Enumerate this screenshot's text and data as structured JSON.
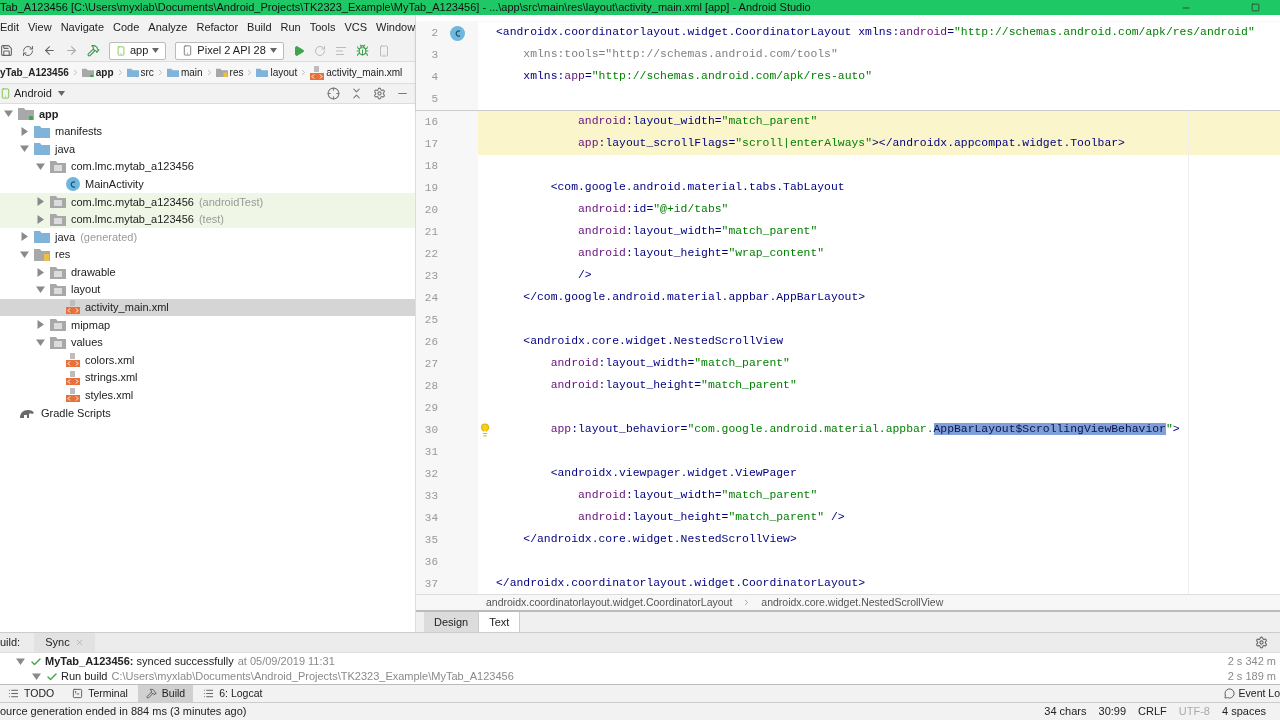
{
  "window": {
    "title": "Tab_A123456 [C:\\Users\\myxlab\\Documents\\Android_Projects\\TK2323_Example\\MyTab_A123456] - ...\\app\\src\\main\\res\\layout\\activity_main.xml [app] - Android Studio"
  },
  "menu": [
    "Edit",
    "View",
    "Navigate",
    "Code",
    "Analyze",
    "Refactor",
    "Build",
    "Run",
    "Tools",
    "VCS",
    "Window"
  ],
  "toolbar": {
    "module": "app",
    "device": "Pixel 2 API 28"
  },
  "breadcrumb": [
    {
      "label": "yTab_A123456",
      "kind": "project"
    },
    {
      "label": "app",
      "kind": "module"
    },
    {
      "label": "src",
      "kind": "folder"
    },
    {
      "label": "main",
      "kind": "folder"
    },
    {
      "label": "res",
      "kind": "res"
    },
    {
      "label": "layout",
      "kind": "folder"
    },
    {
      "label": "activity_main.xml",
      "kind": "xml"
    }
  ],
  "project": {
    "view": "Android",
    "tree": [
      {
        "label": "app",
        "kind": "module",
        "selected": false,
        "highlighted": false,
        "expanded": true,
        "children": [
          {
            "label": "manifests",
            "kind": "folder",
            "selected": false,
            "highlighted": false,
            "expanded": false
          },
          {
            "label": "java",
            "kind": "folder",
            "selected": false,
            "highlighted": false,
            "expanded": true,
            "children": [
              {
                "label": "com.lmc.mytab_a123456",
                "kind": "package",
                "selected": false,
                "highlighted": false,
                "expanded": true,
                "children": [
                  {
                    "label": "MainActivity",
                    "kind": "class",
                    "selected": false,
                    "highlighted": false
                  }
                ]
              },
              {
                "label": "com.lmc.mytab_a123456",
                "suffix": "(androidTest)",
                "kind": "package",
                "selected": false,
                "highlighted": true,
                "expanded": false
              },
              {
                "label": "com.lmc.mytab_a123456",
                "suffix": "(test)",
                "kind": "package",
                "selected": false,
                "highlighted": true,
                "expanded": false
              }
            ]
          },
          {
            "label": "java",
            "suffix": "(generated)",
            "kind": "generated",
            "selected": false,
            "highlighted": false,
            "expanded": false
          },
          {
            "label": "res",
            "kind": "res",
            "selected": false,
            "highlighted": false,
            "expanded": true,
            "children": [
              {
                "label": "drawable",
                "kind": "package",
                "selected": false,
                "highlighted": false,
                "expanded": false
              },
              {
                "label": "layout",
                "kind": "package",
                "selected": false,
                "highlighted": false,
                "expanded": true,
                "children": [
                  {
                    "label": "activity_main.xml",
                    "kind": "xml",
                    "selected": true,
                    "highlighted": false
                  }
                ]
              },
              {
                "label": "mipmap",
                "kind": "package",
                "selected": false,
                "highlighted": false,
                "expanded": false
              },
              {
                "label": "values",
                "kind": "package",
                "selected": false,
                "highlighted": false,
                "expanded": true,
                "children": [
                  {
                    "label": "colors.xml",
                    "kind": "xml",
                    "selected": false,
                    "highlighted": false
                  },
                  {
                    "label": "strings.xml",
                    "kind": "xml",
                    "selected": false,
                    "highlighted": false
                  },
                  {
                    "label": "styles.xml",
                    "kind": "xml",
                    "selected": false,
                    "highlighted": false
                  }
                ]
              }
            ]
          }
        ]
      },
      {
        "label": "Gradle Scripts",
        "kind": "gradle",
        "selected": false,
        "highlighted": false
      }
    ]
  },
  "editor": {
    "sticky_lines": [
      {
        "number": "2",
        "highlighted": false,
        "kind": "class",
        "segments": [
          {
            "text": "<androidx.coordinatorlayout.widget.CoordinatorLayout ",
            "kind": "tag"
          },
          {
            "text": "xmlns:",
            "kind": "attr"
          },
          {
            "text": "android",
            "kind": "ns"
          },
          {
            "text": "=",
            "kind": "attr"
          },
          {
            "text": "\"http://schemas.android.com/apk/res/android\"",
            "kind": "value"
          }
        ]
      },
      {
        "number": "3",
        "highlighted": false,
        "kind": "plain",
        "segments": [
          {
            "text": "    xmlns:tools=\"http://schemas.android.com/tools\"",
            "kind": "unused"
          }
        ]
      },
      {
        "number": "4",
        "highlighted": false,
        "kind": "plain",
        "segments": [
          {
            "text": "    xmlns:",
            "kind": "attr"
          },
          {
            "text": "app",
            "kind": "ns"
          },
          {
            "text": "=",
            "kind": "attr"
          },
          {
            "text": "\"http://schemas.android.com/apk/res-auto\"",
            "kind": "value"
          }
        ]
      },
      {
        "number": "5",
        "highlighted": false,
        "kind": "plain"
      }
    ],
    "lines": [
      {
        "number": "16",
        "highlighted": true,
        "kind": "plain",
        "segments": [
          {
            "text": "            android",
            "kind": "ns"
          },
          {
            "text": ":layout_width=",
            "kind": "attr"
          },
          {
            "text": "\"match_parent\"",
            "kind": "value"
          }
        ]
      },
      {
        "number": "17",
        "highlighted": true,
        "kind": "plain",
        "segments": [
          {
            "text": "            app",
            "kind": "ns"
          },
          {
            "text": ":layout_scrollFlags=",
            "kind": "attr"
          },
          {
            "text": "\"scroll|enterAlways\"",
            "kind": "value"
          },
          {
            "text": "></androidx.appcompat.widget.Toolbar>",
            "kind": "tag"
          }
        ]
      },
      {
        "number": "18",
        "highlighted": false,
        "kind": "plain"
      },
      {
        "number": "19",
        "highlighted": false,
        "kind": "plain",
        "segments": [
          {
            "text": "        <com.google.android.material.tabs.TabLayout",
            "kind": "tag"
          }
        ]
      },
      {
        "number": "20",
        "highlighted": false,
        "kind": "plain",
        "segments": [
          {
            "text": "            android",
            "kind": "ns"
          },
          {
            "text": ":id=",
            "kind": "attr"
          },
          {
            "text": "\"@+id/tabs\"",
            "kind": "value"
          }
        ]
      },
      {
        "number": "21",
        "highlighted": false,
        "kind": "plain",
        "segments": [
          {
            "text": "            android",
            "kind": "ns"
          },
          {
            "text": ":layout_width=",
            "kind": "attr"
          },
          {
            "text": "\"match_parent\"",
            "kind": "value"
          }
        ]
      },
      {
        "number": "22",
        "highlighted": false,
        "kind": "plain",
        "segments": [
          {
            "text": "            android",
            "kind": "ns"
          },
          {
            "text": ":layout_height=",
            "kind": "attr"
          },
          {
            "text": "\"wrap_content\"",
            "kind": "value"
          }
        ]
      },
      {
        "number": "23",
        "highlighted": false,
        "kind": "plain",
        "segments": [
          {
            "text": "            />",
            "kind": "tag"
          }
        ]
      },
      {
        "number": "24",
        "highlighted": false,
        "kind": "plain",
        "segments": [
          {
            "text": "    </com.google.android.material.appbar.AppBarLayout>",
            "kind": "tag"
          }
        ]
      },
      {
        "number": "25",
        "highlighted": false,
        "kind": "plain"
      },
      {
        "number": "26",
        "highlighted": false,
        "kind": "plain",
        "segments": [
          {
            "text": "    <androidx.core.widget.NestedScrollView",
            "kind": "tag"
          }
        ]
      },
      {
        "number": "27",
        "highlighted": false,
        "kind": "plain",
        "segments": [
          {
            "text": "        android",
            "kind": "ns"
          },
          {
            "text": ":layout_width=",
            "kind": "attr"
          },
          {
            "text": "\"match_parent\"",
            "kind": "value"
          }
        ]
      },
      {
        "number": "28",
        "highlighted": false,
        "kind": "plain",
        "segments": [
          {
            "text": "        android",
            "kind": "ns"
          },
          {
            "text": ":layout_height=",
            "kind": "attr"
          },
          {
            "text": "\"match_parent\"",
            "kind": "value"
          }
        ]
      },
      {
        "number": "29",
        "highlighted": false,
        "kind": "plain"
      },
      {
        "number": "30",
        "highlighted": false,
        "kind": "bulb",
        "segments": [
          {
            "text": "        app",
            "kind": "ns"
          },
          {
            "text": ":layout_behavior=",
            "kind": "attr"
          },
          {
            "text": "\"com.google.android.material.appbar.",
            "kind": "value"
          },
          {
            "text": "AppBarLayout$ScrollingViewBehavior",
            "kind": "selected"
          },
          {
            "text": "\"",
            "kind": "value"
          },
          {
            "text": ">",
            "kind": "tag"
          }
        ]
      },
      {
        "number": "31",
        "highlighted": false,
        "kind": "plain"
      },
      {
        "number": "32",
        "highlighted": false,
        "kind": "plain",
        "segments": [
          {
            "text": "        <androidx.viewpager.widget.ViewPager",
            "kind": "tag"
          }
        ]
      },
      {
        "number": "33",
        "highlighted": false,
        "kind": "plain",
        "segments": [
          {
            "text": "            android",
            "kind": "ns"
          },
          {
            "text": ":layout_width=",
            "kind": "attr"
          },
          {
            "text": "\"match_parent\"",
            "kind": "value"
          }
        ]
      },
      {
        "number": "34",
        "highlighted": false,
        "kind": "plain",
        "segments": [
          {
            "text": "            android",
            "kind": "ns"
          },
          {
            "text": ":layout_height=",
            "kind": "attr"
          },
          {
            "text": "\"match_parent\"",
            "kind": "value"
          },
          {
            "text": " />",
            "kind": "tag"
          }
        ]
      },
      {
        "number": "35",
        "highlighted": false,
        "kind": "plain",
        "segments": [
          {
            "text": "    </androidx.core.widget.NestedScrollView>",
            "kind": "tag"
          }
        ]
      },
      {
        "number": "36",
        "highlighted": false,
        "kind": "plain"
      },
      {
        "number": "37",
        "highlighted": false,
        "kind": "plain",
        "segments": [
          {
            "text": "</androidx.coordinatorlayout.widget.CoordinatorLayout>",
            "kind": "tag"
          }
        ]
      }
    ],
    "path": [
      "androidx.coordinatorlayout.widget.CoordinatorLayout",
      "androidx.core.widget.NestedScrollView"
    ],
    "tabs": [
      {
        "label": "Design",
        "selected": false
      },
      {
        "label": "Text",
        "selected": true
      }
    ]
  },
  "build": {
    "label": "uild:",
    "tab": "Sync",
    "rows": [
      {
        "label": "**MyTab_A123456:** synced successfully",
        "detail": "at 05/09/2019 11:31",
        "time": "2 s 342 m",
        "expanded": true,
        "children": [
          {
            "label": "Run build",
            "detail": "C:\\Users\\myxlab\\Documents\\Android_Projects\\TK2323_Example\\MyTab_A123456",
            "time": "2 s 189 m",
            "expanded": true
          }
        ]
      }
    ]
  },
  "tool_tabs": [
    {
      "label": "TODO",
      "kind": "list",
      "selected": false
    },
    {
      "label": "Terminal",
      "kind": "terminal",
      "selected": false
    },
    {
      "label": "Build",
      "kind": "hammer",
      "selected": true
    },
    {
      "label": "6: Logcat",
      "kind": "list",
      "selected": false
    }
  ],
  "event_log": "Event Lo",
  "status_bar": {
    "message": "ource generation ended in 884 ms (3 minutes ago)",
    "items": [
      {
        "text": "34 chars",
        "disabled": false
      },
      {
        "text": "30:99",
        "disabled": false
      },
      {
        "text": "CRLF",
        "disabled": false
      },
      {
        "text": "UTF-8",
        "disabled": true
      },
      {
        "text": "4 spaces",
        "disabled": false
      }
    ]
  }
}
